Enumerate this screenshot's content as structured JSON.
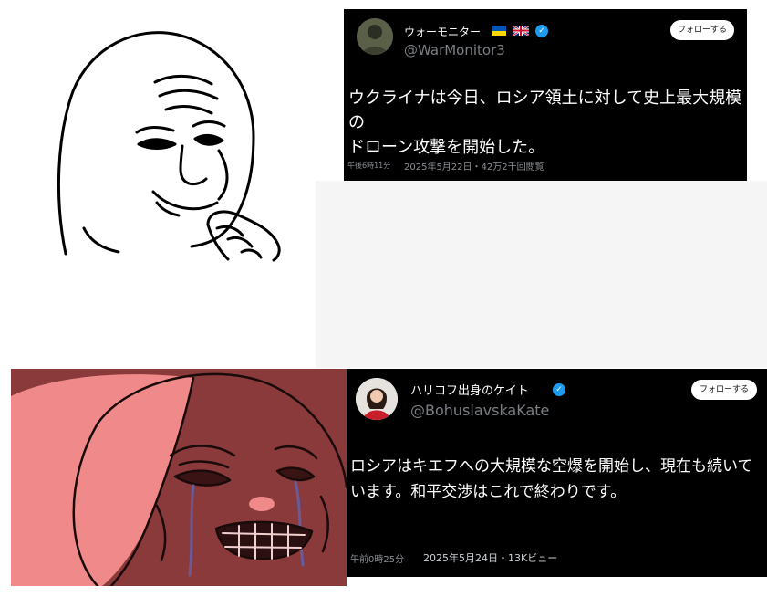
{
  "tweet_top": {
    "display_name": "ウォーモニター",
    "handle": "@WarMonitor3",
    "follow_label": "フォローする",
    "text_line1": "ウクライナは今日、ロシア領土に対して史上最大規模の",
    "text_line2": "ドローン攻撃を開始した。",
    "time": "午後6時11分",
    "meta": "2025年5月22日・42万2千回閲覧"
  },
  "tweet_bottom": {
    "display_name": "ハリコフ出身のケイト",
    "handle": "@BohuslavskaKate",
    "follow_label": "フォローする",
    "text_line1": "ロシアはキエフへの大規模な空爆を開始し、現在も続いて",
    "text_line2": "います。和平交渉はこれで終わりです。",
    "time": "午前0時25分",
    "meta": "2025年5月24日・13Kビュー"
  },
  "colors": {
    "tweet_bg": "#000000",
    "verified": "#1d9bf0",
    "crying_bg": "#8a3a3a",
    "crying_face": "#f08a8a"
  },
  "icons": [
    "ukraine-flag-icon",
    "uk-flag-icon",
    "verified-badge-icon"
  ]
}
